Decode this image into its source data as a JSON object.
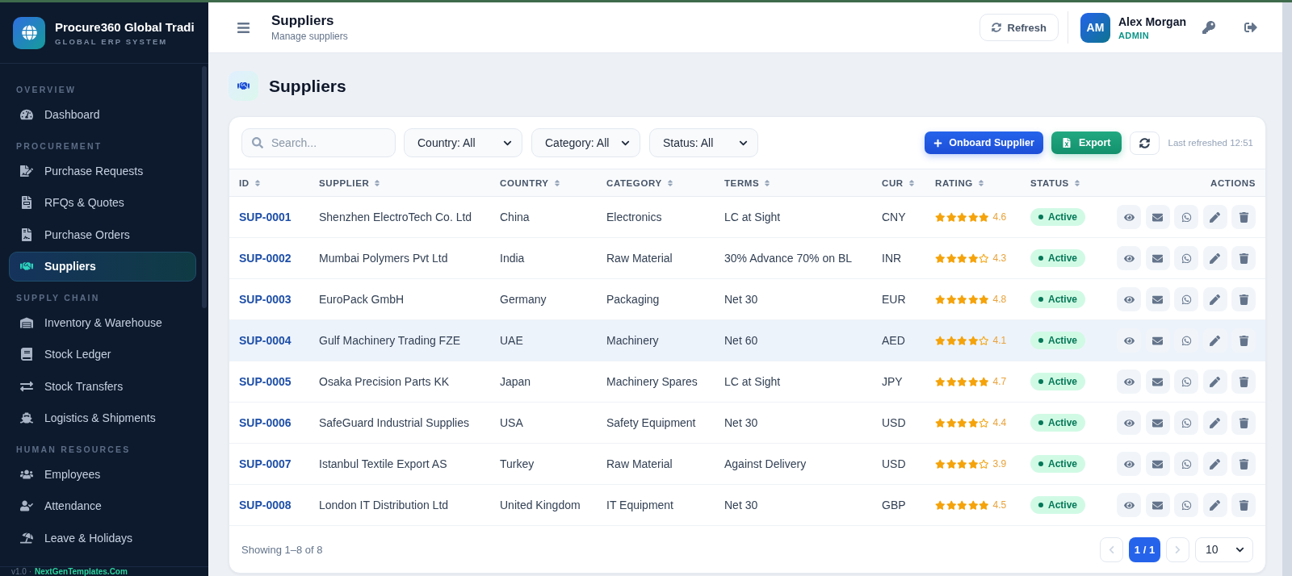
{
  "sidebar": {
    "brand": {
      "name": "Procure360 Global Tradi",
      "tagline": "GLOBAL ERP SYSTEM"
    },
    "sections": [
      {
        "label": "OVERVIEW",
        "items": [
          {
            "label": "Dashboard",
            "selected": false
          }
        ]
      },
      {
        "label": "PROCUREMENT",
        "items": [
          {
            "label": "Purchase Requests",
            "selected": false
          },
          {
            "label": "RFQs & Quotes",
            "selected": false
          },
          {
            "label": "Purchase Orders",
            "selected": false
          },
          {
            "label": "Suppliers",
            "selected": true
          }
        ]
      },
      {
        "label": "SUPPLY CHAIN",
        "items": [
          {
            "label": "Inventory & Warehouse",
            "selected": false
          },
          {
            "label": "Stock Ledger",
            "selected": false
          },
          {
            "label": "Stock Transfers",
            "selected": false
          },
          {
            "label": "Logistics & Shipments",
            "selected": false
          }
        ]
      },
      {
        "label": "HUMAN RESOURCES",
        "items": [
          {
            "label": "Employees",
            "selected": false
          },
          {
            "label": "Attendance",
            "selected": false
          },
          {
            "label": "Leave & Holidays",
            "selected": false
          }
        ]
      }
    ],
    "footer": {
      "version": "v1.0 ·",
      "link": "NextGenTemplates.Com"
    }
  },
  "header": {
    "title": "Suppliers",
    "subtitle": "Manage suppliers",
    "refresh_button": "Refresh",
    "user": {
      "initials": "AM",
      "name": "Alex Morgan",
      "role": "ADMIN"
    }
  },
  "page": {
    "title": "Suppliers"
  },
  "toolbar": {
    "search": {
      "placeholder": "Search..."
    },
    "filters": [
      {
        "label": "Country: All"
      },
      {
        "label": "Category: All"
      },
      {
        "label": "Status: All"
      }
    ],
    "onboard_button": "Onboard Supplier",
    "export_button": "Export",
    "last_refreshed": "Last refreshed 12:51"
  },
  "table": {
    "columns": [
      {
        "label": "ID",
        "sortable": true
      },
      {
        "label": "SUPPLIER",
        "sortable": true
      },
      {
        "label": "COUNTRY",
        "sortable": true
      },
      {
        "label": "CATEGORY",
        "sortable": true
      },
      {
        "label": "TERMS",
        "sortable": true
      },
      {
        "label": "CUR",
        "sortable": true
      },
      {
        "label": "RATING",
        "sortable": true
      },
      {
        "label": "STATUS",
        "sortable": true
      },
      {
        "label": "ACTIONS",
        "sortable": false
      }
    ],
    "rows": [
      {
        "id": "SUP-0001",
        "supplier": "Shenzhen ElectroTech Co. Ltd",
        "country": "China",
        "category": "Electronics",
        "terms": "LC at Sight",
        "currency": "CNY",
        "stars": 5,
        "rating": "4.6",
        "status": "Active",
        "hovered": false
      },
      {
        "id": "SUP-0002",
        "supplier": "Mumbai Polymers Pvt Ltd",
        "country": "India",
        "category": "Raw Material",
        "terms": "30% Advance 70% on BL",
        "currency": "INR",
        "stars": 4,
        "rating": "4.3",
        "status": "Active",
        "hovered": false
      },
      {
        "id": "SUP-0003",
        "supplier": "EuroPack GmbH",
        "country": "Germany",
        "category": "Packaging",
        "terms": "Net 30",
        "currency": "EUR",
        "stars": 5,
        "rating": "4.8",
        "status": "Active",
        "hovered": false
      },
      {
        "id": "SUP-0004",
        "supplier": "Gulf Machinery Trading FZE",
        "country": "UAE",
        "category": "Machinery",
        "terms": "Net 60",
        "currency": "AED",
        "stars": 4,
        "rating": "4.1",
        "status": "Active",
        "hovered": true
      },
      {
        "id": "SUP-0005",
        "supplier": "Osaka Precision Parts KK",
        "country": "Japan",
        "category": "Machinery Spares",
        "terms": "LC at Sight",
        "currency": "JPY",
        "stars": 5,
        "rating": "4.7",
        "status": "Active",
        "hovered": false
      },
      {
        "id": "SUP-0006",
        "supplier": "SafeGuard Industrial Supplies",
        "country": "USA",
        "category": "Safety Equipment",
        "terms": "Net 30",
        "currency": "USD",
        "stars": 4,
        "rating": "4.4",
        "status": "Active",
        "hovered": false
      },
      {
        "id": "SUP-0007",
        "supplier": "Istanbul Textile Export AS",
        "country": "Turkey",
        "category": "Raw Material",
        "terms": "Against Delivery",
        "currency": "USD",
        "stars": 4,
        "rating": "3.9",
        "status": "Active",
        "hovered": false
      },
      {
        "id": "SUP-0008",
        "supplier": "London IT Distribution Ltd",
        "country": "United Kingdom",
        "category": "IT Equipment",
        "terms": "Net 30",
        "currency": "GBP",
        "stars": 5,
        "rating": "4.5",
        "status": "Active",
        "hovered": false
      }
    ]
  },
  "pagination": {
    "summary": "Showing 1–8 of 8",
    "previous_disabled": true,
    "page": "1 / 1",
    "next_disabled": true,
    "page_size": "10"
  }
}
